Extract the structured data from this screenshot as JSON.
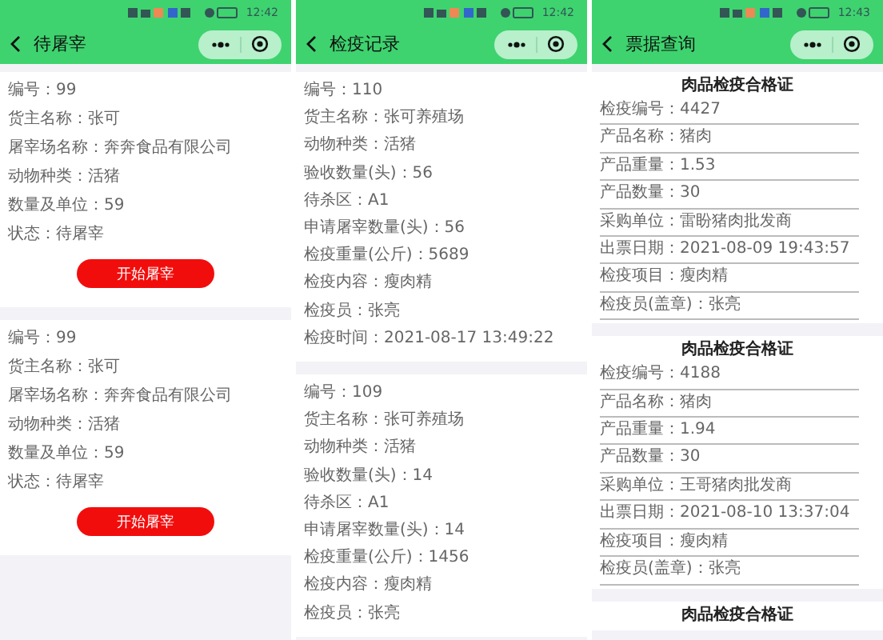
{
  "panels": [
    {
      "time": "12:42",
      "title": "待屠宰",
      "kind": "slaughter",
      "cards": [
        {
          "lines": [
            "编号：99",
            "货主名称：张可",
            "屠宰场名称：奔奔食品有限公司",
            "动物种类：活猪",
            "数量及单位：59",
            "状态：待屠宰"
          ],
          "button": "开始屠宰"
        },
        {
          "lines": [
            "编号：99",
            "货主名称：张可",
            "屠宰场名称：奔奔食品有限公司",
            "动物种类：活猪",
            "数量及单位：59",
            "状态：待屠宰"
          ],
          "button": "开始屠宰"
        }
      ]
    },
    {
      "time": "12:42",
      "title": "检疫记录",
      "kind": "record",
      "cards": [
        {
          "lines": [
            "编号：110",
            "货主名称：张可养殖场",
            "动物种类：活猪",
            "验收数量(头)：56",
            "待杀区：A1",
            "申请屠宰数量(头)：56",
            "检疫重量(公斤)：5689",
            "检疫内容：瘦肉精",
            "检疫员：张亮",
            "检疫时间：2021-08-17 13:49:22"
          ]
        },
        {
          "lines": [
            "编号：109",
            "货主名称：张可养殖场",
            "动物种类：活猪",
            "验收数量(头)：14",
            "待杀区：A1",
            "申请屠宰数量(头)：14",
            "检疫重量(公斤)：1456",
            "检疫内容：瘦肉精",
            "检疫员：张亮"
          ]
        }
      ]
    },
    {
      "time": "12:43",
      "title": "票据查询",
      "kind": "certificate",
      "cards": [
        {
          "heading": "肉品检疫合格证",
          "lines": [
            "检疫编号：4427",
            "产品名称：猪肉",
            "产品重量：1.53",
            "产品数量：30",
            "采购单位：雷盼猪肉批发商",
            "出票日期：2021-08-09 19:43:57",
            "检疫项目：瘦肉精",
            "检疫员(盖章)：张亮"
          ]
        },
        {
          "heading": "肉品检疫合格证",
          "lines": [
            "检疫编号：4188",
            "产品名称：猪肉",
            "产品重量：1.94",
            "产品数量：30",
            "采购单位：王哥猪肉批发商",
            "出票日期：2021-08-10 13:37:04",
            "检疫项目：瘦肉精",
            "检疫员(盖章)：张亮"
          ]
        },
        {
          "heading": "肉品检疫合格证"
        }
      ]
    }
  ]
}
